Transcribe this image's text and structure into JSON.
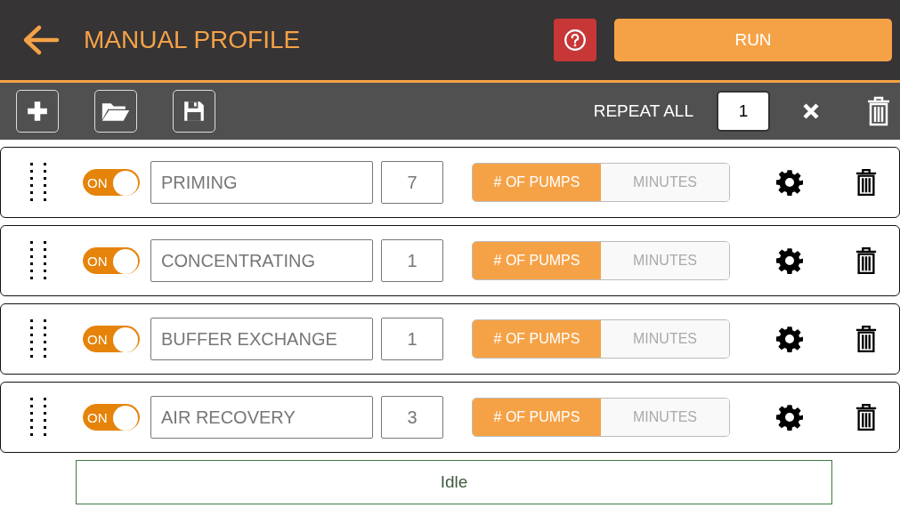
{
  "header": {
    "title": "MANUAL PROFILE",
    "run_label": "RUN"
  },
  "toolbar": {
    "repeat_label": "REPEAT ALL",
    "repeat_value": "1"
  },
  "steps": [
    {
      "on": true,
      "toggle_label": "ON",
      "name": "PRIMING",
      "count": "7",
      "modes": [
        {
          "label": "# OF PUMPS",
          "selected": true
        },
        {
          "label": "MINUTES",
          "selected": false
        }
      ]
    },
    {
      "on": true,
      "toggle_label": "ON",
      "name": "CONCENTRATING",
      "count": "1",
      "modes": [
        {
          "label": "# OF PUMPS",
          "selected": true
        },
        {
          "label": "MINUTES",
          "selected": false
        }
      ]
    },
    {
      "on": true,
      "toggle_label": "ON",
      "name": "BUFFER EXCHANGE",
      "count": "1",
      "modes": [
        {
          "label": "# OF PUMPS",
          "selected": true
        },
        {
          "label": "MINUTES",
          "selected": false
        }
      ]
    },
    {
      "on": true,
      "toggle_label": "ON",
      "name": "AIR RECOVERY",
      "count": "3",
      "modes": [
        {
          "label": "# OF PUMPS",
          "selected": true
        },
        {
          "label": "MINUTES",
          "selected": false
        }
      ]
    }
  ],
  "status": "Idle"
}
